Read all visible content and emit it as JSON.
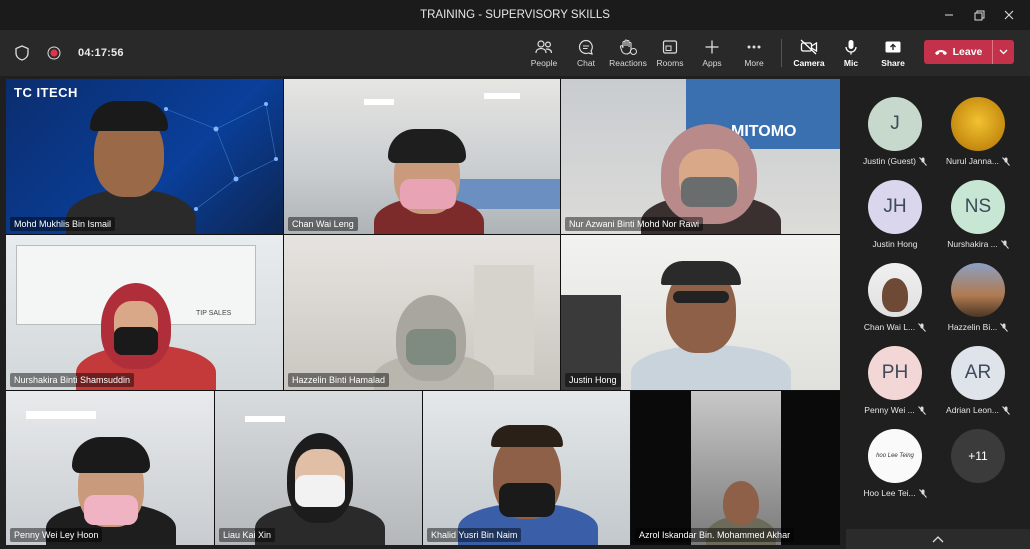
{
  "window": {
    "title": "TRAINING - SUPERVISORY SKILLS"
  },
  "toolbar": {
    "timer": "04:17:56",
    "people": "People",
    "chat": "Chat",
    "reactions": "Reactions",
    "rooms": "Rooms",
    "apps": "Apps",
    "more": "More",
    "camera": "Camera",
    "mic": "Mic",
    "share": "Share",
    "leave": "Leave"
  },
  "video_tiles": [
    {
      "name": "Mohd Mukhlis Bin Ismail",
      "logo": "TC ITECH"
    },
    {
      "name": "Chan Wai Leng"
    },
    {
      "name": "Nur Azwani Binti Mohd Nor Rawi",
      "background_sign": "MITOMO"
    },
    {
      "name": "Nurshakira Binti Shamsuddin",
      "board_text": "TIP SALES"
    },
    {
      "name": "Hazzelin Binti Hamalad"
    },
    {
      "name": "Justin Hong"
    },
    {
      "name": "Penny Wei Ley Hoon"
    },
    {
      "name": "Liau Kai Xin"
    },
    {
      "name": "Khalid Yusri Bin Naim"
    },
    {
      "name": "Azrol Iskandar Bin. Mohammed Akhar"
    }
  ],
  "participants": [
    {
      "initials": "J",
      "name": "Justin (Guest)"
    },
    {
      "initials": "",
      "name": "Nurul Janna..."
    },
    {
      "initials": "JH",
      "name": "Justin Hong"
    },
    {
      "initials": "NS",
      "name": "Nurshakira ..."
    },
    {
      "initials": "",
      "name": "Chan Wai L..."
    },
    {
      "initials": "",
      "name": "Hazzelin Bi..."
    },
    {
      "initials": "PH",
      "name": "Penny Wei ..."
    },
    {
      "initials": "AR",
      "name": "Adrian Leon..."
    },
    {
      "initials": "",
      "name": "Hoo Lee Tei...",
      "avatar_text": "hoo Lee Teing"
    },
    {
      "initials": "+11",
      "name": ""
    }
  ],
  "colors": {
    "leave": "#c4314b",
    "avatar_bg": "#c8d6e5",
    "avatar_text": "#3d4a5a",
    "pink_avatar": "#f3d6d6"
  }
}
